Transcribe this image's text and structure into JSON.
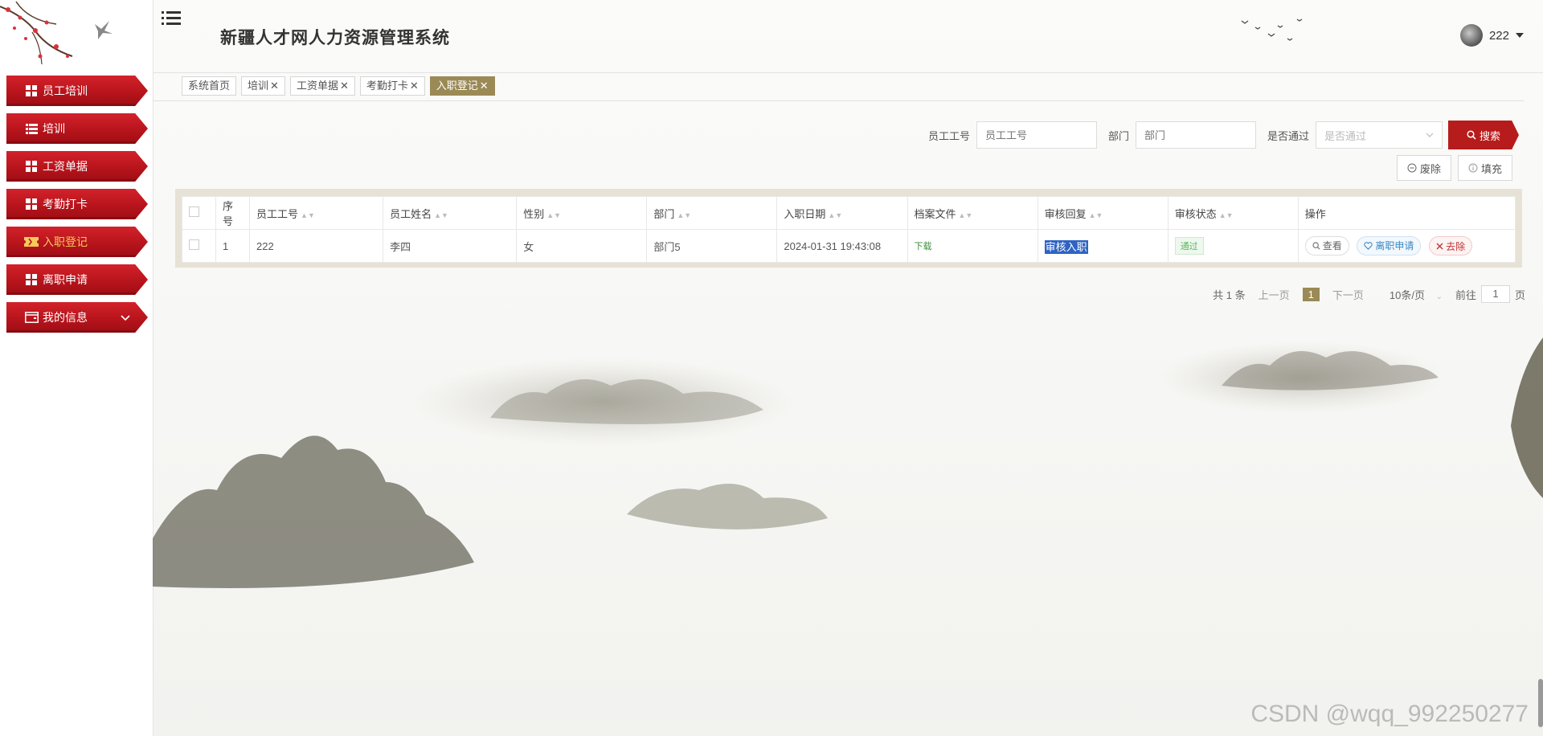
{
  "header": {
    "title": "新疆人才网人力资源管理系统",
    "user": "222"
  },
  "sidebar": {
    "items": [
      {
        "label": "员工培训",
        "icon": "grid-icon"
      },
      {
        "label": "培训",
        "icon": "list-icon"
      },
      {
        "label": "工资单据",
        "icon": "grid-icon"
      },
      {
        "label": "考勤打卡",
        "icon": "grid-icon"
      },
      {
        "label": "入职登记",
        "icon": "ticket-icon",
        "active": true
      },
      {
        "label": "离职申请",
        "icon": "grid-icon"
      },
      {
        "label": "我的信息",
        "icon": "wallet-icon"
      }
    ]
  },
  "tabs": [
    {
      "label": "系统首页",
      "closable": false
    },
    {
      "label": "培训",
      "closable": true
    },
    {
      "label": "工资单据",
      "closable": true
    },
    {
      "label": "考勤打卡",
      "closable": true
    },
    {
      "label": "入职登记",
      "closable": true,
      "active": true
    }
  ],
  "search": {
    "employee_no_label": "员工工号",
    "employee_no_placeholder": "员工工号",
    "department_label": "部门",
    "department_placeholder": "部门",
    "passed_label": "是否通过",
    "passed_placeholder": "是否通过",
    "button": "搜索"
  },
  "actions": {
    "discard": "废除",
    "fill": "填充"
  },
  "table": {
    "headers": {
      "index": "序号",
      "employee_no": "员工工号",
      "employee_name": "员工姓名",
      "gender": "性别",
      "department": "部门",
      "entry_date": "入职日期",
      "file": "档案文件",
      "review_reply": "审核回复",
      "review_status": "审核状态",
      "ops": "操作"
    },
    "rows": [
      {
        "index": "1",
        "employee_no": "222",
        "employee_name": "李四",
        "gender": "女",
        "department": "部门5",
        "entry_date": "2024-01-31 19:43:08",
        "file_link": "下载",
        "review_reply": "审核入职",
        "review_status": "通过",
        "op_view": "查看",
        "op_resign": "离职申请",
        "op_delete": "去除"
      }
    ]
  },
  "pagination": {
    "total": "共 1 条",
    "prev": "上一页",
    "current": "1",
    "next": "下一页",
    "page_size": "10条/页",
    "goto_label": "前往",
    "goto_value": "1",
    "page_suffix": "页"
  },
  "watermark": "CSDN @wqq_992250277",
  "colors": {
    "menu_red": "#b8141c",
    "active_gold": "#9b8a56",
    "search_red": "#b71c1c"
  }
}
